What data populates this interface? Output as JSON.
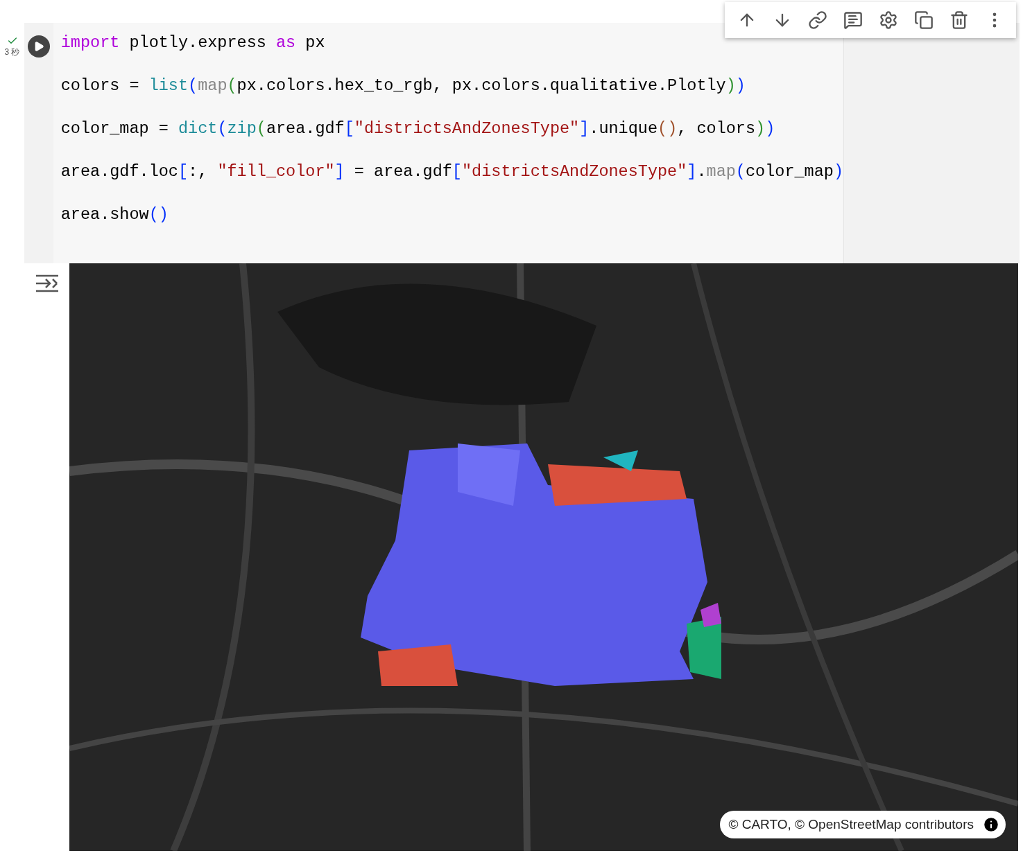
{
  "cell": {
    "status": {
      "done": true,
      "time": "3 秒"
    },
    "code": [
      [
        {
          "kind": "keyword",
          "text": "import"
        },
        {
          "kind": "plain",
          "text": " plotly.express "
        },
        {
          "kind": "keyword",
          "text": "as"
        },
        {
          "kind": "plain",
          "text": " px"
        }
      ],
      [
        {
          "kind": "plain",
          "text": "colors = "
        },
        {
          "kind": "builtin",
          "text": "list"
        },
        {
          "kind": "bracket1",
          "text": "("
        },
        {
          "kind": "func",
          "text": "map"
        },
        {
          "kind": "bracket2",
          "text": "("
        },
        {
          "kind": "plain",
          "text": "px.colors.hex_to_rgb, px.colors.qualitative.Plotly"
        },
        {
          "kind": "bracket2",
          "text": ")"
        },
        {
          "kind": "bracket1",
          "text": ")"
        }
      ],
      [
        {
          "kind": "plain",
          "text": "color_map = "
        },
        {
          "kind": "builtin",
          "text": "dict"
        },
        {
          "kind": "bracket1",
          "text": "("
        },
        {
          "kind": "builtin",
          "text": "zip"
        },
        {
          "kind": "bracket2",
          "text": "("
        },
        {
          "kind": "plain",
          "text": "area.gdf"
        },
        {
          "kind": "bracket3",
          "text": "["
        },
        {
          "kind": "string",
          "text": "\"districtsAndZonesType\""
        },
        {
          "kind": "bracket3",
          "text": "]"
        },
        {
          "kind": "plain",
          "text": ".unique"
        },
        {
          "kind": "bracket4",
          "text": "()"
        },
        {
          "kind": "plain",
          "text": ", colors"
        },
        {
          "kind": "bracket2",
          "text": ")"
        },
        {
          "kind": "bracket1",
          "text": ")"
        }
      ],
      [
        {
          "kind": "plain",
          "text": "area.gdf.loc"
        },
        {
          "kind": "bracket1",
          "text": "["
        },
        {
          "kind": "plain",
          "text": ":, "
        },
        {
          "kind": "string",
          "text": "\"fill_color\""
        },
        {
          "kind": "bracket1",
          "text": "]"
        },
        {
          "kind": "plain",
          "text": " = area.gdf"
        },
        {
          "kind": "bracket1",
          "text": "["
        },
        {
          "kind": "string",
          "text": "\"districtsAndZonesType\""
        },
        {
          "kind": "bracket1",
          "text": "]"
        },
        {
          "kind": "plain",
          "text": "."
        },
        {
          "kind": "func",
          "text": "map"
        },
        {
          "kind": "bracket1",
          "text": "("
        },
        {
          "kind": "plain",
          "text": "color_map"
        },
        {
          "kind": "bracket1",
          "text": ")"
        }
      ],
      [
        {
          "kind": "plain",
          "text": "area.show"
        },
        {
          "kind": "bracket1",
          "text": "()"
        }
      ]
    ],
    "toolbar": [
      {
        "kind": "up"
      },
      {
        "kind": "down"
      },
      {
        "kind": "link"
      },
      {
        "kind": "comment"
      },
      {
        "kind": "settings"
      },
      {
        "kind": "mirror"
      },
      {
        "kind": "delete"
      },
      {
        "kind": "more"
      }
    ],
    "output": {
      "attribution": "© CARTO, © OpenStreetMap contributors"
    }
  }
}
